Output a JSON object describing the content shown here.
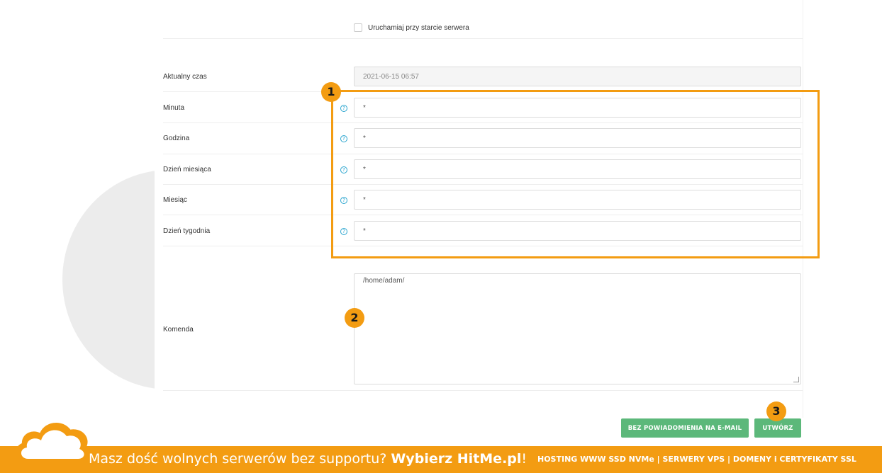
{
  "form": {
    "startup_checkbox_label": "Uruchamiaj przy starcie serwera",
    "current_time": {
      "label": "Aktualny czas",
      "value": "2021-06-15 06:57"
    },
    "minute": {
      "label": "Minuta",
      "value": "*"
    },
    "hour": {
      "label": "Godzina",
      "value": "*"
    },
    "day_of_month": {
      "label": "Dzień miesiąca",
      "value": "*"
    },
    "month": {
      "label": "Miesiąc",
      "value": "*"
    },
    "day_of_week": {
      "label": "Dzień tygodnia",
      "value": "*"
    },
    "command": {
      "label": "Komenda",
      "value": "/home/adam/"
    },
    "help_icon_glyph": "?"
  },
  "buttons": {
    "no_email_label": "BEZ POWIADOMIENIA NA E-MAIL",
    "create_label": "UTWÓRZ"
  },
  "annotations": {
    "badge_1": "1",
    "badge_2": "2",
    "badge_3": "3"
  },
  "footer": {
    "promo_text": "Masz dość wolnych serwerów bez supportu? ",
    "promo_bold": "Wybierz HitMe.pl",
    "promo_end": "!",
    "links": "HOSTING WWW SSD NVMe | SERWERY VPS | DOMENY i CERTYFIKATY SSL"
  },
  "colors": {
    "accent_orange": "#f39c12",
    "button_green": "#5cb87a",
    "help_blue": "#2aa5cf"
  }
}
